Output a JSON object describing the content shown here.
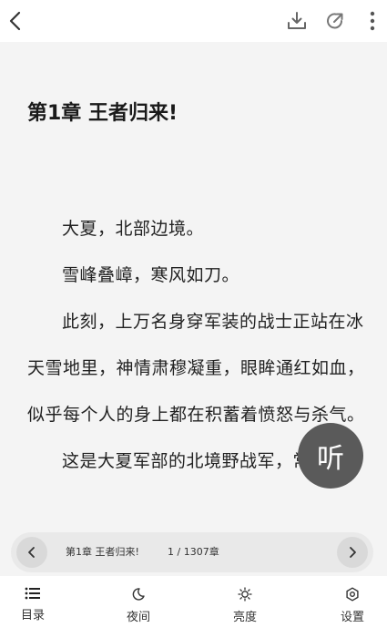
{
  "chapter": {
    "title": "第1章 王者归来!",
    "paragraphs": [
      "大夏，北部边境。",
      "雪峰叠嶂，寒风如刀。",
      "此刻，上万名身穿军装的战士正站在冰天雪地里，神情肃穆凝重，眼眸通红如血，似乎每个人的身上都在积蓄着愤怒与杀气。",
      "这是大夏军部的北境野战军，常年镇"
    ]
  },
  "listen_button": {
    "label": "听"
  },
  "progress": {
    "chapter_name": "第1章 王者归来!",
    "position": "1 / 1307章"
  },
  "bottom_nav": {
    "items": [
      {
        "label": "目录",
        "icon": "list-icon"
      },
      {
        "label": "夜间",
        "icon": "moon-icon"
      },
      {
        "label": "亮度",
        "icon": "sun-icon"
      },
      {
        "label": "设置",
        "icon": "gear-icon"
      }
    ]
  },
  "top_bar": {
    "icons": [
      "back-arrow-icon",
      "download-icon",
      "share-icon",
      "more-vertical-icon"
    ]
  }
}
